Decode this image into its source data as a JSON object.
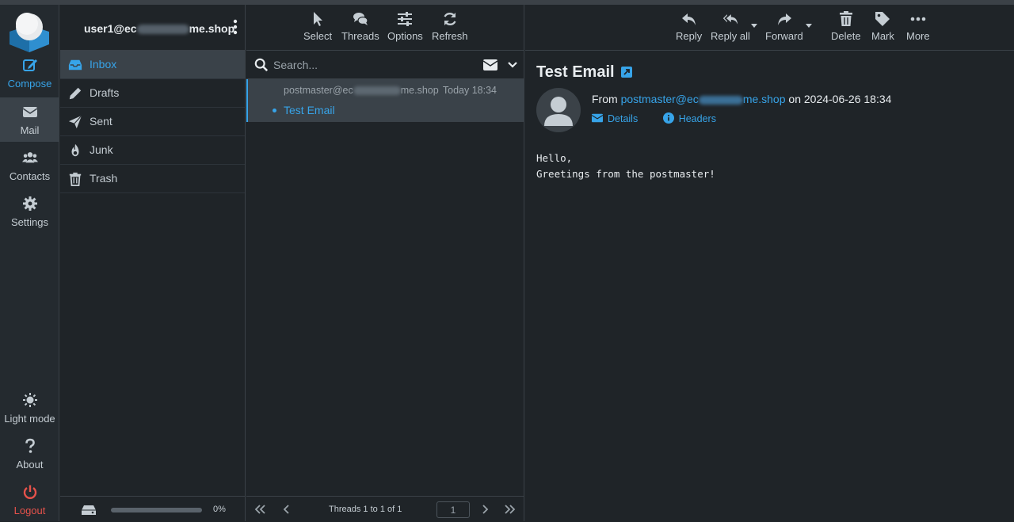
{
  "taskmenu": {
    "compose": "Compose",
    "mail": "Mail",
    "contacts": "Contacts",
    "settings": "Settings",
    "lightmode": "Light mode",
    "about": "About",
    "logout": "Logout"
  },
  "account": {
    "prefix": "user1@ec",
    "suffix": "me.shop"
  },
  "folders": [
    {
      "label": "Inbox",
      "icon": "inbox-icon"
    },
    {
      "label": "Drafts",
      "icon": "pencil-icon"
    },
    {
      "label": "Sent",
      "icon": "paper-plane-icon"
    },
    {
      "label": "Junk",
      "icon": "fire-icon"
    },
    {
      "label": "Trash",
      "icon": "trash-icon"
    }
  ],
  "quota": {
    "percent": "0%",
    "used_fraction": 0
  },
  "list_toolbar": {
    "select": "Select",
    "threads": "Threads",
    "options": "Options",
    "refresh": "Refresh"
  },
  "search": {
    "placeholder": "Search..."
  },
  "messages": [
    {
      "from_prefix": "postmaster@ec",
      "from_suffix": "me.shop",
      "date": "Today 18:34",
      "subject": "Test Email"
    }
  ],
  "pager": {
    "count": "Threads 1 to 1 of 1",
    "page": "1"
  },
  "content_toolbar": {
    "reply": "Reply",
    "replyall": "Reply all",
    "forward": "Forward",
    "delete": "Delete",
    "mark": "Mark",
    "more": "More"
  },
  "message": {
    "subject": "Test Email",
    "from_label": "From",
    "from_prefix": "postmaster@ec",
    "from_suffix": "me.shop",
    "date_text": "on 2024-06-26 18:34",
    "details": "Details",
    "headers": "Headers",
    "body": "Hello,\nGreetings from the postmaster!"
  },
  "colors": {
    "accent": "#37a4e9",
    "logout": "#e6524b",
    "background": "#1f2428"
  }
}
